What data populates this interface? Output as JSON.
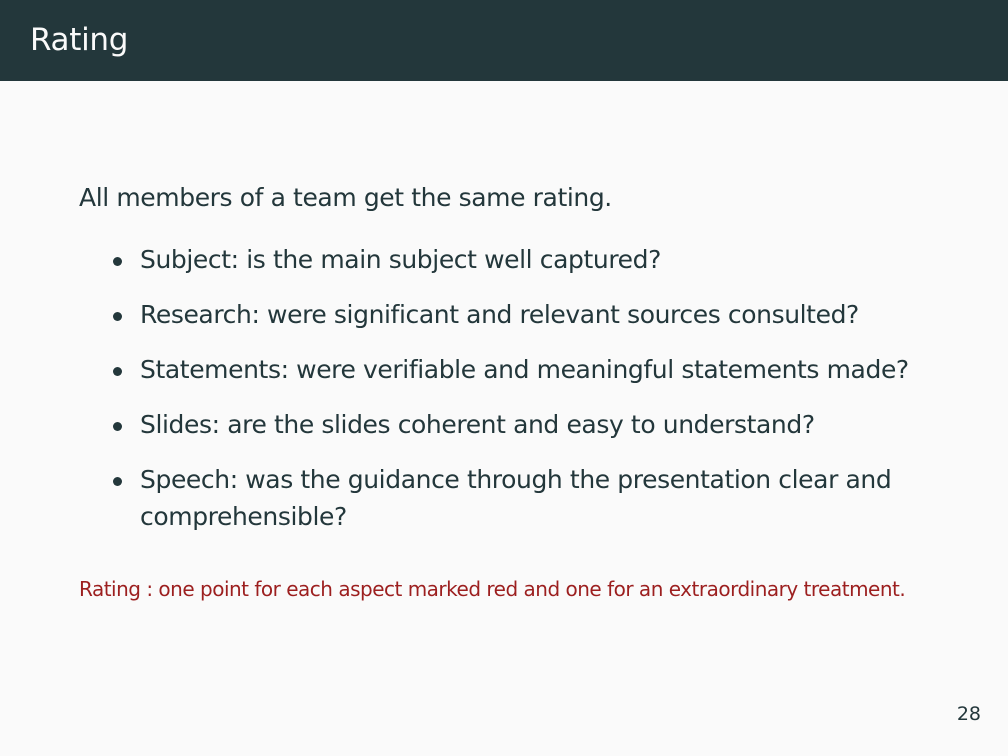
{
  "slide": {
    "title": "Rating",
    "intro": "All members of a team get the same rating.",
    "bullets": [
      "Subject: is the main subject well captured?",
      "Research: were significant and relevant sources consulted?",
      "Statements: were verifiable and meaningful statements made?",
      "Slides: are the slides coherent and easy to understand?",
      "Speech: was the guidance through the presentation clear and comprehensible?"
    ],
    "note": "Rating : one point for each aspect marked red and one for an extraordinary treatment.",
    "page_number": "28"
  },
  "colors": {
    "title_bar": "#23373b",
    "background": "#fafafa",
    "text": "#23373b",
    "note_text": "#9c1f1f"
  }
}
